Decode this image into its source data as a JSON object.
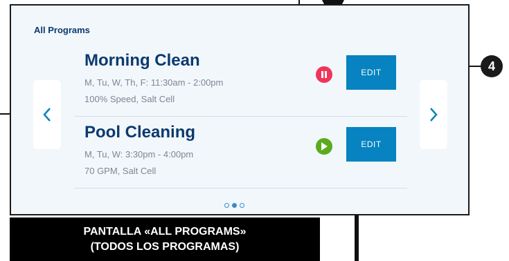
{
  "screen": {
    "section_title": "All Programs",
    "programs": [
      {
        "name": "Morning Clean",
        "schedule": "M, Tu, W, Th, F: 11:30am - 2:00pm",
        "detail": "100% Speed, Salt Cell",
        "status": "paused",
        "status_icon": "pause-icon",
        "edit_label": "EDIT"
      },
      {
        "name": "Pool Cleaning",
        "schedule": "M, Tu, W: 3:30pm - 4:00pm",
        "detail": "70 GPM, Salt Cell",
        "status": "running",
        "status_icon": "play-icon",
        "edit_label": "EDIT"
      }
    ],
    "pagination": {
      "pages": 3,
      "current": 2
    },
    "nav_icons": {
      "prev": "chevron-left-icon",
      "next": "chevron-right-icon"
    }
  },
  "callouts": {
    "number": "4"
  },
  "caption": {
    "line1": "PANTALLA «ALL PROGRAMS»",
    "line2": "(TODOS LOS PROGRAMAS)"
  },
  "colors": {
    "accent": "#0683c0",
    "title": "#0b3a6e",
    "pause": "#f0355b",
    "play": "#5aab1e"
  }
}
